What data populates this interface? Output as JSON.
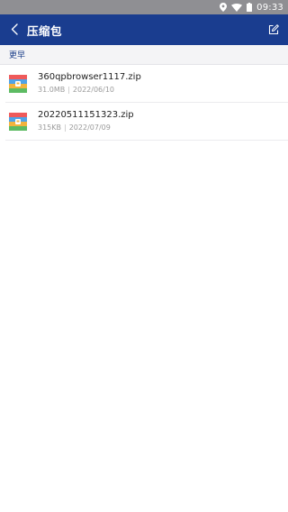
{
  "status_bar": {
    "time": "09:33",
    "icons": [
      "location-icon",
      "wifi-icon",
      "battery-icon"
    ]
  },
  "app_bar": {
    "title": "压缩包",
    "back_icon": "chevron-left-icon",
    "action_icon": "edit-icon",
    "background": "#1a3d8f"
  },
  "section": {
    "label": "更早"
  },
  "files": [
    {
      "name": "360qpbrowser1117.zip",
      "size": "31.0MB",
      "separator": "|",
      "date": "2022/06/10",
      "icon": "zip-archive-icon"
    },
    {
      "name": "20220511151323.zip",
      "size": "315KB",
      "separator": "|",
      "date": "2022/07/09",
      "icon": "zip-archive-icon"
    }
  ]
}
